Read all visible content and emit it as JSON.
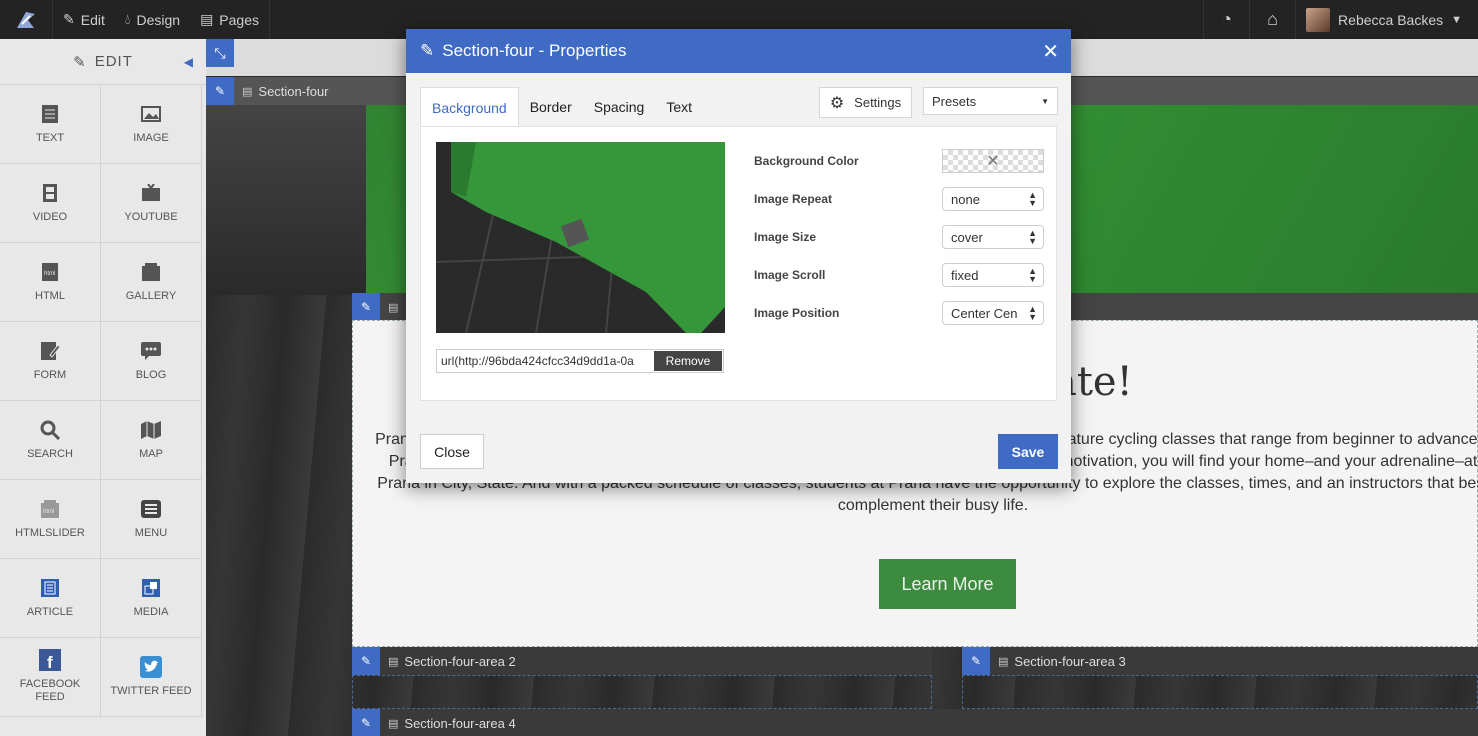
{
  "topbar": {
    "edit_label": "Edit",
    "design_label": "Design",
    "pages_label": "Pages",
    "user_name": "Rebecca Backes"
  },
  "sidebar": {
    "title": "EDIT",
    "tiles": [
      {
        "label": "TEXT",
        "icon": "text-icon"
      },
      {
        "label": "IMAGE",
        "icon": "image-icon"
      },
      {
        "label": "VIDEO",
        "icon": "video-icon"
      },
      {
        "label": "YOUTUBE",
        "icon": "youtube-icon"
      },
      {
        "label": "HTML",
        "icon": "html-icon"
      },
      {
        "label": "GALLERY",
        "icon": "gallery-icon"
      },
      {
        "label": "FORM",
        "icon": "form-icon"
      },
      {
        "label": "BLOG",
        "icon": "blog-icon"
      },
      {
        "label": "SEARCH",
        "icon": "search-icon"
      },
      {
        "label": "MAP",
        "icon": "map-icon"
      },
      {
        "label": "HTMLSLIDER",
        "icon": "htmlslider-icon"
      },
      {
        "label": "MENU",
        "icon": "menu-icon"
      },
      {
        "label": "ARTICLE",
        "icon": "article-icon"
      },
      {
        "label": "MEDIA",
        "icon": "media-icon"
      },
      {
        "label": "FACEBOOK FEED",
        "icon": "facebook-icon"
      },
      {
        "label": "TWITTER FEED",
        "icon": "twitter-icon"
      }
    ]
  },
  "canvas": {
    "section_label": "Section-four",
    "area2_label": "Section-four-area 2",
    "area3_label": "Section-four-area 3",
    "area4_label": "Section-four-area 4",
    "heading": "ate!",
    "paragraph": "Prana cycle studio in City, State is the newest, hottest group exercise option in the Area. With signature cycling classes that range from beginner to advanced, Prana caters to every level of fitness. Whether you are new to exercise or in search of workout motivation, you will find your home–and your adrenaline–at Prana in City, State. And with a packed schedule of classes, students at Prana have the opportunity to explore the classes, times, and an instructors that best complement their busy life.",
    "learn_more": "Learn More"
  },
  "modal": {
    "title": "Section-four - Properties",
    "tabs": [
      "Background",
      "Border",
      "Spacing",
      "Text"
    ],
    "settings_label": "Settings",
    "presets_value": "Presets",
    "url_value": "url(http://96bda424cfcc34d9dd1a-0a",
    "remove_label": "Remove",
    "props": {
      "bg_color_label": "Background Color",
      "repeat_label": "Image Repeat",
      "repeat_value": "none",
      "size_label": "Image Size",
      "size_value": "cover",
      "scroll_label": "Image Scroll",
      "scroll_value": "fixed",
      "position_label": "Image Position",
      "position_value": "Center Cen"
    },
    "close_label": "Close",
    "save_label": "Save"
  },
  "colors": {
    "accent": "#3f6bc4",
    "button_green": "#3d8b3f"
  }
}
